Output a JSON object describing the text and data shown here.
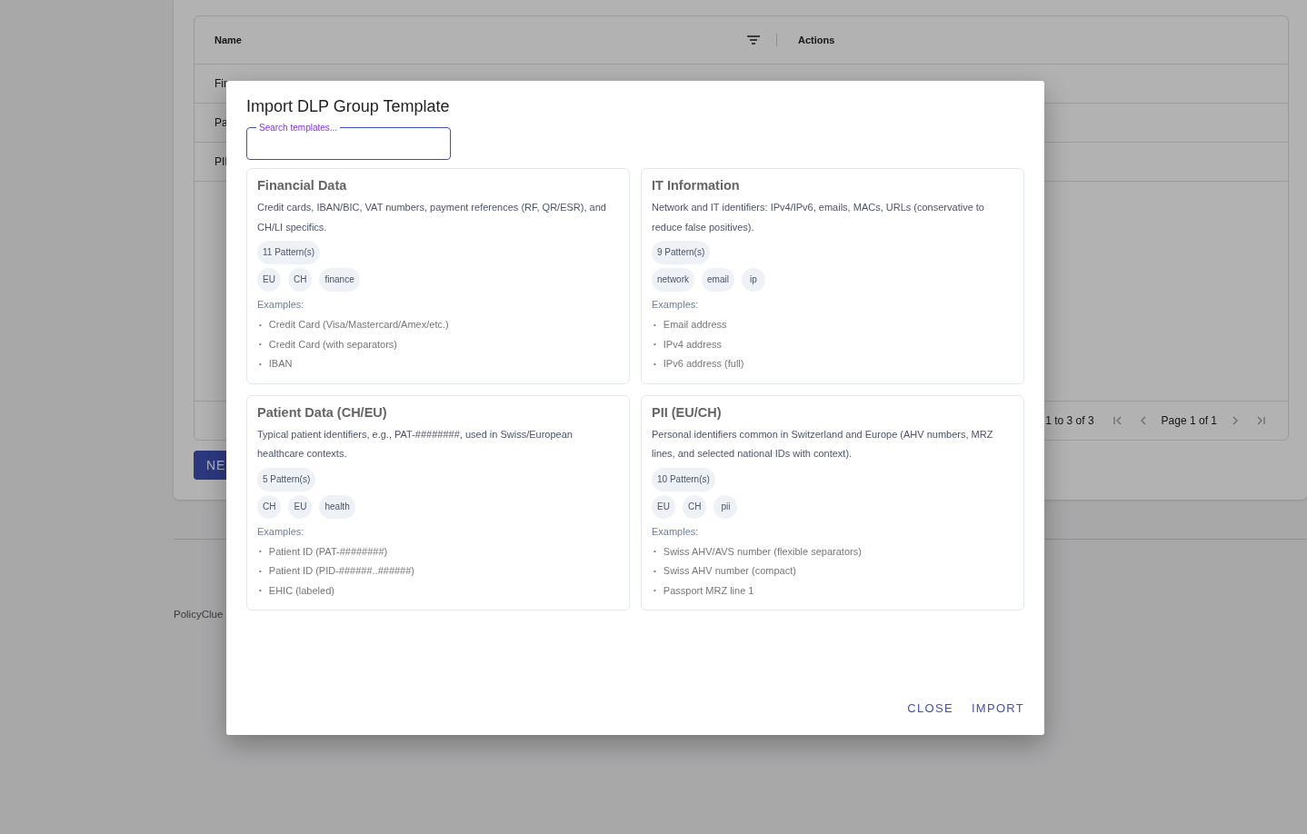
{
  "background": {
    "table": {
      "columns": [
        {
          "label": "Name"
        },
        {
          "label": "Actions"
        }
      ],
      "rows": [
        {
          "name": "Fin"
        },
        {
          "name": "Pa"
        },
        {
          "name": "PII"
        }
      ],
      "footer": {
        "range": "1 to 3 of 3",
        "page": "Page 1 of 1"
      }
    },
    "new_button": "NE",
    "footer_text": "PolicyClue"
  },
  "dialog": {
    "title": "Import DLP Group Template",
    "search": {
      "label": "Search templates..."
    },
    "bullet": "•",
    "templates": [
      {
        "title": "Financial Data",
        "description": "Credit cards, IBAN/BIC, VAT numbers, payment references (RF, QR/ESR), and CH/LI specifics.",
        "patterns": "11 Pattern(s)",
        "tags": [
          "EU",
          "CH",
          "finance"
        ],
        "examples_label": "Examples:",
        "examples": [
          "Credit Card (Visa/Mastercard/Amex/etc.)",
          "Credit Card (with separators)",
          "IBAN"
        ]
      },
      {
        "title": "IT Information",
        "description": "Network and IT identifiers: IPv4/IPv6, emails, MACs, URLs (conservative to reduce false positives).",
        "patterns": "9 Pattern(s)",
        "tags": [
          "network",
          "email",
          "ip"
        ],
        "examples_label": "Examples:",
        "examples": [
          "Email address",
          "IPv4 address",
          "IPv6 address (full)"
        ]
      },
      {
        "title": "Patient Data (CH/EU)",
        "description": "Typical patient identifiers, e.g., PAT-########, used in Swiss/European healthcare contexts.",
        "patterns": "5 Pattern(s)",
        "tags": [
          "CH",
          "EU",
          "health"
        ],
        "examples_label": "Examples:",
        "examples": [
          "Patient ID (PAT-########)",
          "Patient ID (PID-######..######)",
          "EHIC (labeled)"
        ]
      },
      {
        "title": "PII (EU/CH)",
        "description": "Personal identifiers common in Switzerland and Europe (AHV numbers, MRZ lines, and selected national IDs with context).",
        "patterns": "10 Pattern(s)",
        "tags": [
          "EU",
          "CH",
          "pii"
        ],
        "examples_label": "Examples:",
        "examples": [
          "Swiss AHV/AVS number (flexible separators)",
          "Swiss AHV number (compact)",
          "Passport MRZ line 1"
        ]
      }
    ],
    "actions": [
      "CLOSE",
      "IMPORT"
    ]
  }
}
